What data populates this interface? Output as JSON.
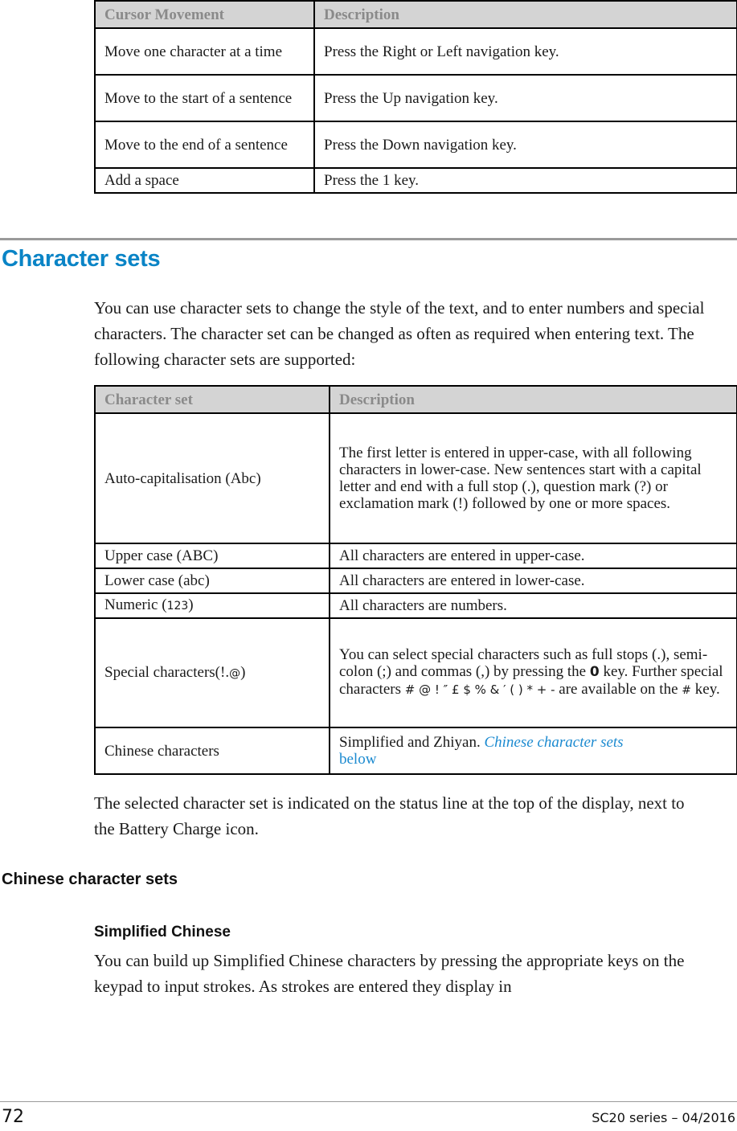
{
  "cursor_table": {
    "headers": [
      "Cursor Movement",
      "Description"
    ],
    "rows": [
      [
        "Move one character at a time",
        "Press the Right or Left navigation key."
      ],
      [
        "Move to the start of a sentence",
        "Press the Up navigation key."
      ],
      [
        "Move to the end of a sentence",
        "Press the Down navigation key."
      ],
      [
        "Add a space",
        "Press the 1 key."
      ]
    ]
  },
  "section": {
    "title": "Character sets",
    "intro": "You can use character sets to change the style of the text, and to enter numbers and special characters. The character set can be changed as often as required when entering text. The following character sets are supported:"
  },
  "charset_table": {
    "headers": [
      "Character set",
      "Description"
    ],
    "rows": [
      {
        "name": "Auto-capitalisation (Abc)",
        "description": "The first letter is entered in upper-case, with all following characters in lower-case. New sentences start with a capital letter and end with a full stop (.), question mark (?) or exclamation mark (!) followed by one or more spaces."
      },
      {
        "name": "Upper case (ABC)",
        "description": "All characters are entered in upper-case."
      },
      {
        "name": "Lower case (abc)",
        "description": "All characters are entered in lower-case."
      },
      {
        "name_prefix": "Numeric (",
        "name_code": "123",
        "name_suffix": ")",
        "description": "All characters are numbers."
      },
      {
        "name_prefix": "Special characters(!.",
        "name_code": "@",
        "name_suffix": ")",
        "desc_part1": "You can select special characters such as full stops (.), semi-colon (;) and commas (,) by pressing the ",
        "desc_key": "0",
        "desc_part2": " key. Further special characters ",
        "desc_symbols": "# @ ! ″ £ $ % & ′ ( ) * + -",
        "desc_part3": " are available on the ",
        "desc_hash": "#",
        "desc_part4": " key."
      },
      {
        "name": "Chinese characters",
        "description": "Simplified and Zhiyan. ",
        "link_part1": "Chinese character sets",
        "link_part2": "below"
      }
    ]
  },
  "status_note": "The selected character set is indicated on the status line at the top of the display, next to the Battery Charge icon.",
  "chinese_section": {
    "title": "Chinese character sets",
    "subsection_title": "Simplified Chinese",
    "body": "You can build up Simplified Chinese characters by pressing the appropriate keys on the keypad to input strokes. As strokes are entered they display in"
  },
  "footer": {
    "page_number": "72",
    "document": "SC20 series – 04/2016"
  },
  "colors": {
    "heading_blue": "#0a84c6",
    "link_blue": "#1b8ad0",
    "table_header_bg": "#d4d4d4",
    "table_header_text": "#8a8a8a"
  }
}
